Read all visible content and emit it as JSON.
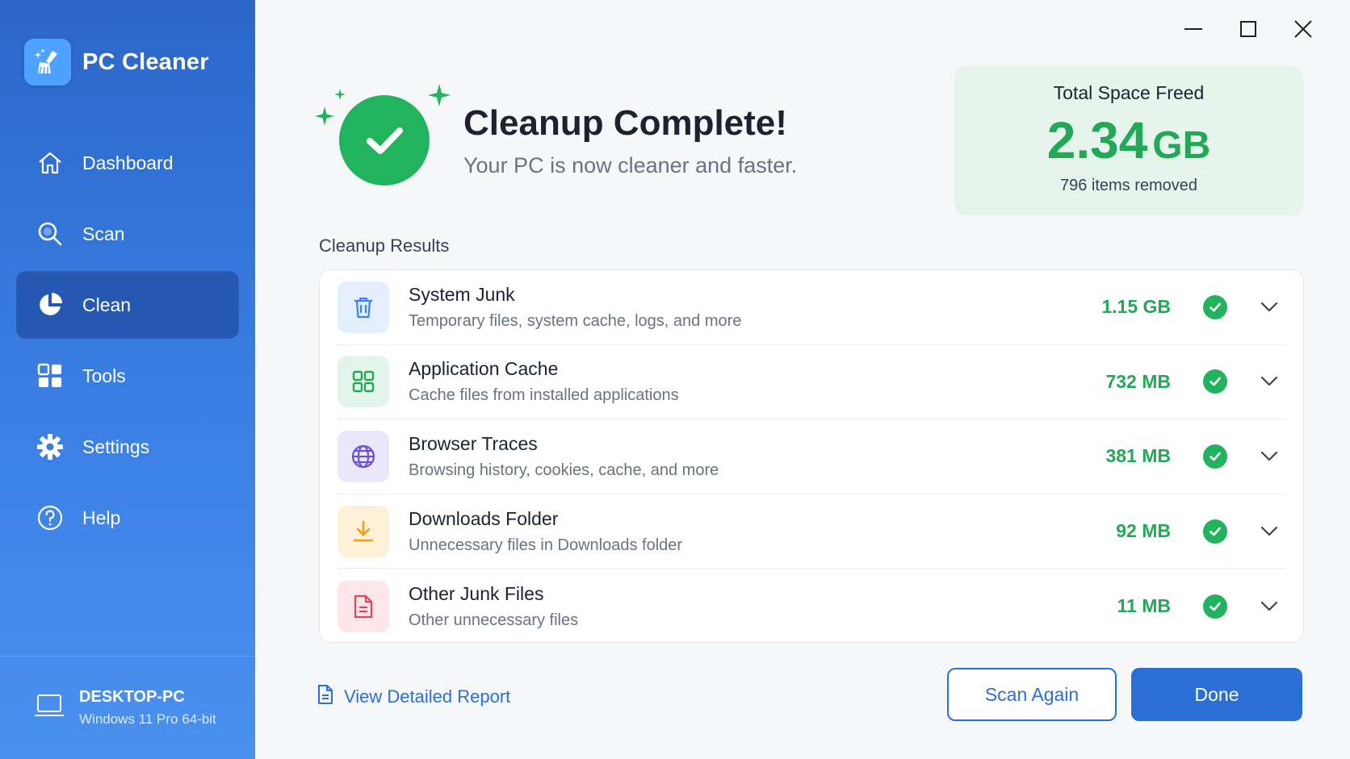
{
  "app": {
    "name": "PC Cleaner"
  },
  "nav": {
    "items": [
      {
        "label": "Dashboard",
        "icon": "home-icon"
      },
      {
        "label": "Scan",
        "icon": "search-icon"
      },
      {
        "label": "Clean",
        "icon": "pie-chart-icon",
        "active": true
      },
      {
        "label": "Tools",
        "icon": "grid-icon"
      },
      {
        "label": "Settings",
        "icon": "gear-icon"
      },
      {
        "label": "Help",
        "icon": "help-icon"
      }
    ]
  },
  "device": {
    "name": "DESKTOP-PC",
    "os": "Windows 11 Pro 64-bit"
  },
  "hero": {
    "title": "Cleanup Complete!",
    "subtitle": "Your PC is now cleaner and faster."
  },
  "summary": {
    "label": "Total Space Freed",
    "value": "2.34",
    "unit": "GB",
    "items": "796 items removed"
  },
  "results": {
    "title": "Cleanup Results",
    "rows": [
      {
        "title": "System Junk",
        "desc": "Temporary files, system cache, logs, and more",
        "size": "1.15 GB",
        "icon": "trash-icon",
        "color": "#3b82f6",
        "bg": "#e3efff"
      },
      {
        "title": "Application Cache",
        "desc": "Cache files from installed applications",
        "size": "732 MB",
        "icon": "apps-grid-icon",
        "color": "#22a857",
        "bg": "#e3f5ea"
      },
      {
        "title": "Browser Traces",
        "desc": "Browsing history, cookies, cache, and more",
        "size": "381 MB",
        "icon": "globe-icon",
        "color": "#6d4fd8",
        "bg": "#ece8fb"
      },
      {
        "title": "Downloads Folder",
        "desc": "Unnecessary files in Downloads folder",
        "size": "92 MB",
        "icon": "download-icon",
        "color": "#f59e0b",
        "bg": "#fdf1d9"
      },
      {
        "title": "Other Junk Files",
        "desc": "Other unnecessary files",
        "size": "11 MB",
        "icon": "document-icon",
        "color": "#e0455a",
        "bg": "#fde6e9"
      }
    ]
  },
  "footer": {
    "report_link": "View Detailed Report",
    "scan_again": "Scan Again",
    "done": "Done"
  },
  "colors": {
    "accent": "#2b6fd6",
    "success": "#22b35e",
    "sidebar": "#2b67c9"
  }
}
